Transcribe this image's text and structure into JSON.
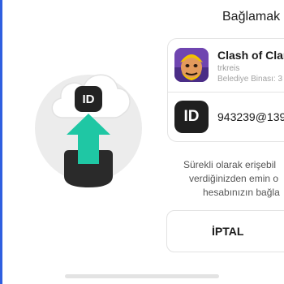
{
  "header": {
    "title": "Bağlamak"
  },
  "illustration": {
    "badge_text": "ID",
    "arrow_color": "#1fc7a4",
    "tray_color": "#2a2a2a",
    "cloud_color": "#ffffff"
  },
  "account_card": {
    "game": {
      "name": "Clash of Clans",
      "username": "trkreis",
      "building": "Belediye Binası: 3",
      "icon": "clash-of-clans-app-icon"
    },
    "id_account": {
      "badge_text": "ID",
      "value": "943239@139"
    }
  },
  "description": {
    "line1": "Sürekli olarak erişebil",
    "line2": "verdiğinizden emin o",
    "line3": "hesabınızın bağla"
  },
  "actions": {
    "cancel_label": "İPTAL"
  },
  "colors": {
    "accent_edge": "#2f5fe0",
    "upload_arrow": "#1fc7a4"
  }
}
